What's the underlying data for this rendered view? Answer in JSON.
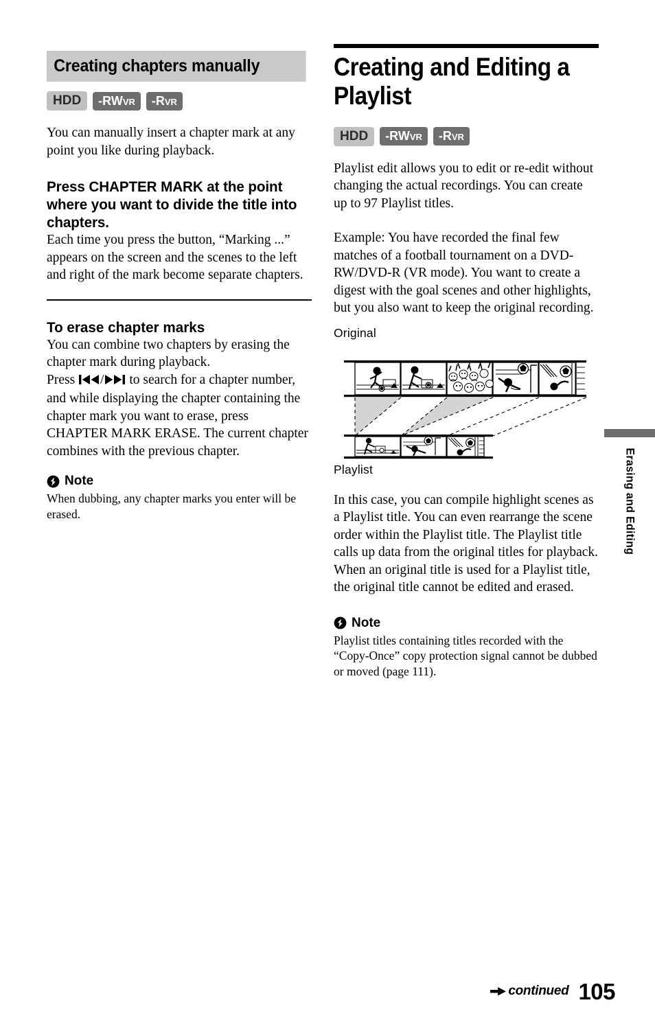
{
  "left_column": {
    "section_title": "Creating chapters manually",
    "badges": [
      {
        "main": "HDD",
        "sub": "",
        "style": "hdd"
      },
      {
        "main": "-RW",
        "sub": "VR",
        "style": "disc"
      },
      {
        "main": "-R",
        "sub": "VR",
        "style": "disc"
      }
    ],
    "intro": "You can manually insert a chapter mark at any point you like during playback.",
    "step_heading": "Press CHAPTER MARK at the point where you want to divide the title into chapters.",
    "step_body": "Each time you press the button, “Marking ...” appears on the screen and the scenes to the left and right of the mark become separate chapters.",
    "subsection_heading": "To erase chapter marks",
    "subsection_body_1": "You can combine two chapters by erasing the chapter mark during playback.",
    "press_prefix": "Press",
    "press_separator": "/",
    "press_suffix": "to search for a chapter number, and while displaying the chapter containing the chapter mark you want to erase, press CHAPTER MARK ERASE. The current chapter combines with the previous chapter.",
    "note": {
      "label": "Note",
      "body": "When dubbing, any chapter marks you enter will be erased."
    }
  },
  "right_column": {
    "section_title": "Creating and Editing a Playlist",
    "badges": [
      {
        "main": "HDD",
        "sub": "",
        "style": "hdd"
      },
      {
        "main": "-RW",
        "sub": "VR",
        "style": "disc"
      },
      {
        "main": "-R",
        "sub": "VR",
        "style": "disc"
      }
    ],
    "intro": "Playlist edit allows you to edit or re-edit without changing the actual recordings. You can create up to 97 Playlist titles.",
    "example": "Example: You have recorded the final few matches of a football tournament on a DVD-RW/DVD-R (VR mode). You want to create a digest with the goal scenes and other highlights, but you also want to keep the original recording.",
    "diagram": {
      "top_label": "Original",
      "bottom_label": "Playlist",
      "original_frames": 5,
      "playlist_frames": 3
    },
    "body_after_diagram": "In this case, you can compile highlight scenes as a Playlist title. You can even rearrange the scene order within the Playlist title. The Playlist title calls up data from the original titles for playback. When an original title is used for a Playlist title, the original title cannot be edited and erased.",
    "note": {
      "label": "Note",
      "body": "Playlist titles containing titles recorded with the “Copy-Once” copy protection signal cannot be dubbed or moved (page 111)."
    }
  },
  "side_tab": {
    "label": "Erasing and Editing"
  },
  "footer": {
    "continued": "continued",
    "page_number": "105"
  },
  "colors": {
    "title_band": "#c9c9c9",
    "badge_hdd_bg": "#c0c0c0",
    "badge_disc_bg": "#6e6e6e",
    "side_tab_bar": "#6e6e6e",
    "diagram_shade": "#d4d4d4"
  }
}
